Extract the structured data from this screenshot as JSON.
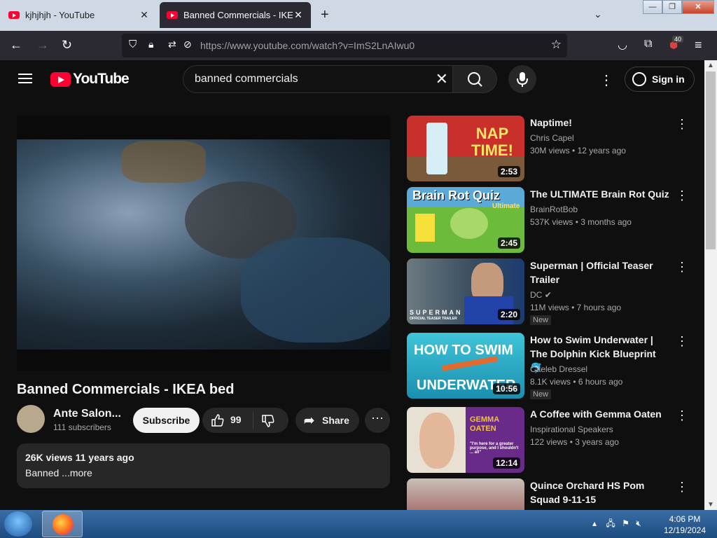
{
  "browser": {
    "tabs": [
      {
        "title": "kjhjhjh - YouTube"
      },
      {
        "title": "Banned Commercials - IKEA be"
      }
    ],
    "url": "https://www.youtube.com/watch?v=ImS2LnAIwu0",
    "extension_badge": "40"
  },
  "youtube": {
    "logo_text": "YouTube",
    "search_value": "banned commercials",
    "sign_in": "Sign in"
  },
  "video": {
    "title": "Banned Commercials - IKEA bed",
    "channel": "Ante Salon...",
    "subscribers": "111 subscribers",
    "subscribe_label": "Subscribe",
    "likes": "99",
    "share_label": "Share",
    "description_meta": "26K views  11 years ago",
    "description_text": "Banned ...more"
  },
  "recommendations": [
    {
      "title": "Naptime!",
      "channel": "Chris Capel",
      "views": "30M views",
      "age": "12 years ago",
      "duration": "2:53",
      "thumb_text": "NAP TIME!"
    },
    {
      "title": "The ULTIMATE Brain Rot Quiz",
      "channel": "BrainRotBob",
      "views": "537K views",
      "age": "3 months ago",
      "duration": "2:45",
      "thumb_text": "Brain Rot Quiz",
      "thumb_sub": "Ultimate"
    },
    {
      "title": "Superman | Official Teaser Trailer",
      "channel": "DC",
      "views": "11M views",
      "age": "7 hours ago",
      "duration": "2:20",
      "badge": "New",
      "thumb_text": "SUPERMAN",
      "thumb_sub": "OFFICIAL TEASER TRAILER"
    },
    {
      "title": "How to Swim Underwater | The Dolphin Kick Blueprint 🐬",
      "channel": "Caeleb Dressel",
      "views": "8.1K views",
      "age": "6 hours ago",
      "duration": "10:56",
      "badge": "New",
      "thumb_text": "HOW TO SWIM",
      "thumb_sub": "UNDERWATER"
    },
    {
      "title": "A Coffee with Gemma Oaten",
      "channel": "Inspirational Speakers",
      "views": "122 views",
      "age": "3 years ago",
      "duration": "12:14",
      "thumb_text": "GEMMA OATEN",
      "thumb_sub": "\"I'm here for a greater purpose, and I shouldn't ... all\""
    },
    {
      "title": "Quince Orchard HS Pom Squad 9-11-15"
    }
  ],
  "taskbar": {
    "time": "4:06 PM",
    "date": "12/19/2024"
  },
  "colors": {
    "youtube_red": "#ff0033",
    "bg": "#0f0f0f",
    "chip": "#272727"
  }
}
